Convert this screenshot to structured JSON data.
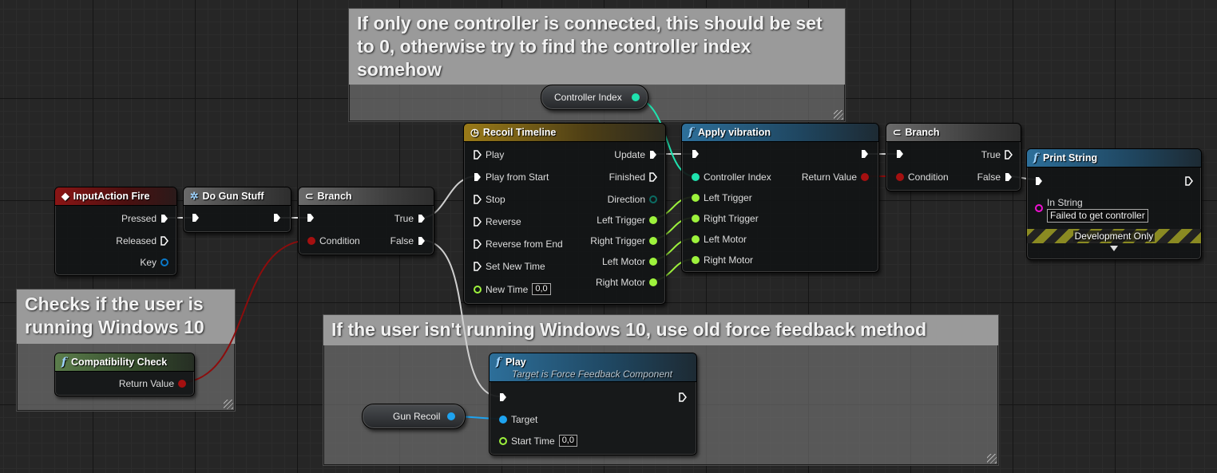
{
  "colors": {
    "exec": "#ffffff",
    "bool": "#8c0d0d",
    "int": "#1fe3af",
    "float": "#9df23c",
    "object": "#1ea3f0",
    "string": "#f010d3",
    "struct": "#0a78c8"
  },
  "comments": {
    "controller": "If only one controller is connected, this should be set to 0, otherwise try to find the controller index somehow",
    "windows10": "Checks if the user is running Windows 10",
    "oldfeedback": "If the user isn't running Windows 10, use old force feedback method"
  },
  "nodes": {
    "input_action": {
      "title": "InputAction Fire",
      "icon": "input-action-icon",
      "pins": {
        "pressed": "Pressed",
        "released": "Released",
        "key": "Key"
      }
    },
    "do_gun_stuff": {
      "title": "Do Gun Stuff",
      "icon": "macro-gear-icon"
    },
    "branch1": {
      "title": "Branch",
      "icon": "branch-icon",
      "pins": {
        "true": "True",
        "false": "False",
        "condition": "Condition"
      }
    },
    "compat_check": {
      "title": "Compatibility Check",
      "icon": "function-icon",
      "pins": {
        "return_value": "Return Value"
      }
    },
    "timeline": {
      "title": "Recoil Timeline",
      "icon": "clock-icon",
      "inputs": {
        "play": "Play",
        "play_from_start": "Play from Start",
        "stop": "Stop",
        "reverse": "Reverse",
        "reverse_from_end": "Reverse from End",
        "set_new_time": "Set New Time",
        "new_time": "New Time",
        "new_time_value": "0,0"
      },
      "outputs": {
        "update": "Update",
        "finished": "Finished",
        "direction": "Direction",
        "left_trigger": "Left Trigger",
        "right_trigger": "Right Trigger",
        "left_motor": "Left Motor",
        "right_motor": "Right Motor"
      }
    },
    "apply_vibration": {
      "title": "Apply vibration",
      "icon": "function-icon",
      "inputs": {
        "controller_index": "Controller Index",
        "left_trigger": "Left Trigger",
        "right_trigger": "Right Trigger",
        "left_motor": "Left Motor",
        "right_motor": "Right Motor"
      },
      "outputs": {
        "return_value": "Return Value"
      }
    },
    "branch2": {
      "title": "Branch",
      "icon": "branch-icon",
      "pins": {
        "true": "True",
        "false": "False",
        "condition": "Condition"
      }
    },
    "print_string": {
      "title": "Print String",
      "icon": "function-icon",
      "pins": {
        "in_string": "In String",
        "in_string_value": "Failed to get controller"
      },
      "dev_only": "Development Only"
    },
    "play": {
      "title": "Play",
      "subtitle": "Target is Force Feedback Component",
      "icon": "function-icon",
      "pins": {
        "target": "Target",
        "start_time": "Start Time",
        "start_time_value": "0,0"
      }
    },
    "controller_index_var": {
      "label": "Controller Index"
    },
    "gun_recoil_var": {
      "label": "Gun Recoil"
    }
  }
}
